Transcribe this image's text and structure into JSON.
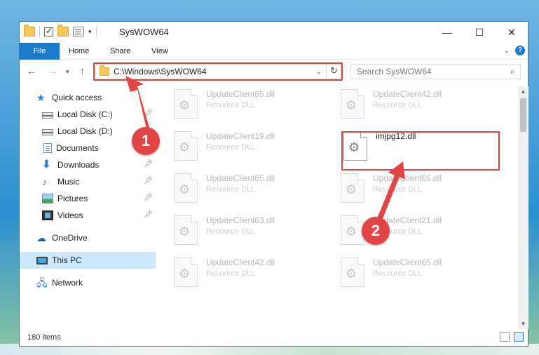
{
  "window": {
    "title": "SysWOW64",
    "controls": {
      "minimize": "—",
      "maximize": "☐",
      "close": "✕"
    }
  },
  "ribbon": {
    "tabs": [
      "File",
      "Home",
      "Share",
      "View"
    ]
  },
  "address": {
    "path": "C:\\Windows\\SysWOW64",
    "search_placeholder": "Search SysWOW64"
  },
  "sidebar": {
    "items": [
      {
        "label": "Quick access",
        "icon": "star-icon"
      },
      {
        "label": "Local Disk (C:)",
        "icon": "disk-icon",
        "pinned": true
      },
      {
        "label": "Local Disk (D:)",
        "icon": "disk-icon"
      },
      {
        "label": "Documents",
        "icon": "documents-icon",
        "pinned": true
      },
      {
        "label": "Downloads",
        "icon": "download-icon",
        "pinned": true
      },
      {
        "label": "Music",
        "icon": "music-icon",
        "pinned": true
      },
      {
        "label": "Pictures",
        "icon": "pictures-icon",
        "pinned": true
      },
      {
        "label": "Videos",
        "icon": "videos-icon",
        "pinned": true
      },
      {
        "label": "OneDrive",
        "icon": "cloud-icon"
      },
      {
        "label": "This PC",
        "icon": "pc-icon",
        "selected": true
      },
      {
        "label": "Network",
        "icon": "network-icon"
      }
    ]
  },
  "files": [
    {
      "name": "UpdateClient65.dll",
      "type": "Resource DLL"
    },
    {
      "name": "UpdateClient42.dll",
      "type": "Resource DLL"
    },
    {
      "name": "UpdateClient19.dll",
      "type": "Resource DLL"
    },
    {
      "name": "imjpg12.dll",
      "type": ""
    },
    {
      "name": "UpdateClient65.dll",
      "type": "Resource DLL"
    },
    {
      "name": "UpdateClient65.dll",
      "type": "Resource DLL"
    },
    {
      "name": "UpdateClient63.dll",
      "type": "Resource DLL"
    },
    {
      "name": "UpdateClient21.dll",
      "type": "Resource DLL"
    },
    {
      "name": "UpdateClient42.dll",
      "type": "Resource DLL"
    },
    {
      "name": "UpdateClient65.dll",
      "type": "Resource DLL"
    }
  ],
  "status": {
    "count": "180 items"
  },
  "callouts": {
    "one": "1",
    "two": "2"
  },
  "colors": {
    "accent": "#1979ca",
    "highlight": "#e04040",
    "selected": "#cce8ff"
  }
}
